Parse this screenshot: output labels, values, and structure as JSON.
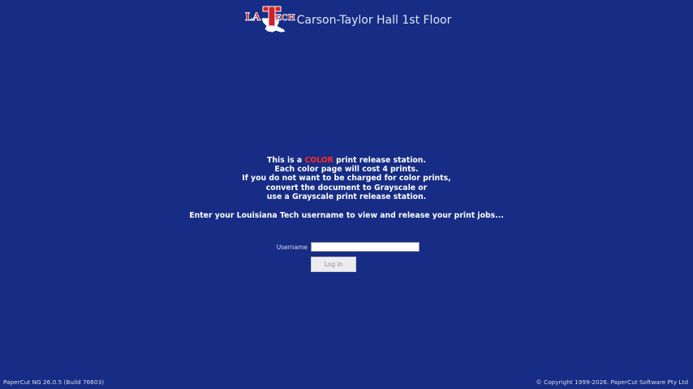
{
  "header": {
    "title": "Carson-Taylor Hall 1st Floor",
    "logo": {
      "text": "LATECH",
      "icon": "latech-logo-icon",
      "colors": {
        "primary": "#d41f27",
        "secondary": "#1c2f8f",
        "outline": "#ffffff"
      }
    }
  },
  "message": {
    "line1_prefix": "This is a ",
    "line1_highlight": "COLOR",
    "line1_suffix": " print release station.",
    "line2": "Each color page will cost 4 prints.",
    "line3": "If you do not want to be charged for color prints,",
    "line4": "convert the document to Grayscale or",
    "line5": "use a Grayscale print release station.",
    "highlight_color": "#ff2a2a"
  },
  "prompt": "Enter your Louisiana Tech username to view and release your print jobs...",
  "form": {
    "username_label": "Username",
    "username_value": "",
    "login_label": "Log in"
  },
  "footer": {
    "version": "PaperCut NG  26.0.5 (Build 76603)",
    "copyright": "© Copyright 1999-2026. PaperCut Software Pty Ltd"
  },
  "theme": {
    "background": "#172c84"
  }
}
